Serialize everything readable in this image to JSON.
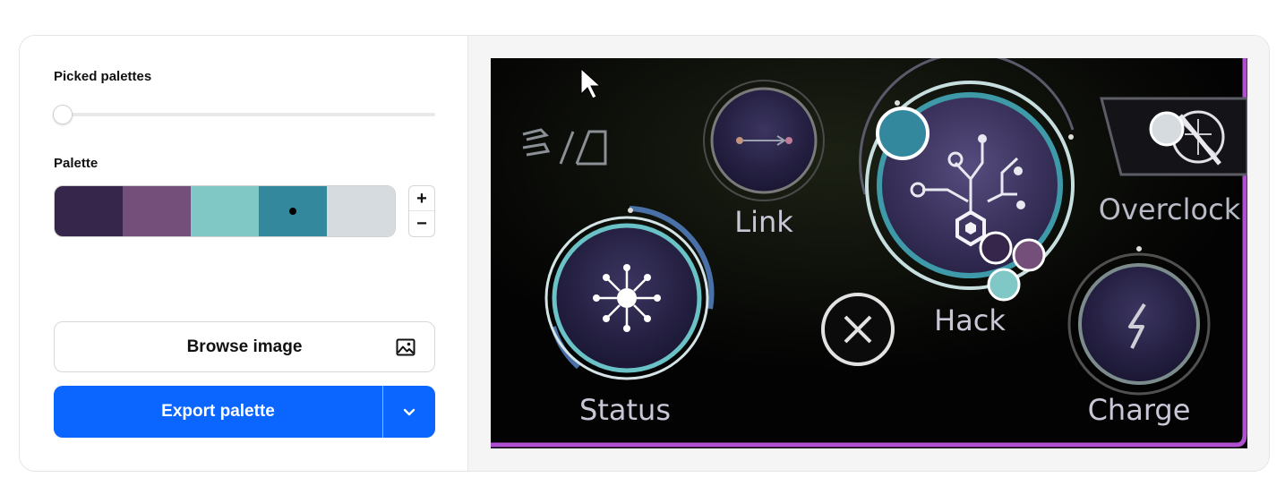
{
  "left_panel": {
    "picked_palettes_label": "Picked palettes",
    "slider_value": 0,
    "palette_label": "Palette",
    "palette": [
      "#37264b",
      "#744f79",
      "#80c8c5",
      "#33889e",
      "#d6dbe0"
    ],
    "selected_swatch_index": 3,
    "stepper": {
      "plus": "+",
      "minus": "−"
    },
    "browse_label": "Browse image",
    "browse_icon": "image-icon",
    "export_label": "Export palette",
    "export_dropdown_icon": "chevron-down-icon"
  },
  "preview": {
    "labels": {
      "link": "Link",
      "overclock": "Overclock",
      "status": "Status",
      "hack": "Hack",
      "charge": "Charge"
    }
  }
}
